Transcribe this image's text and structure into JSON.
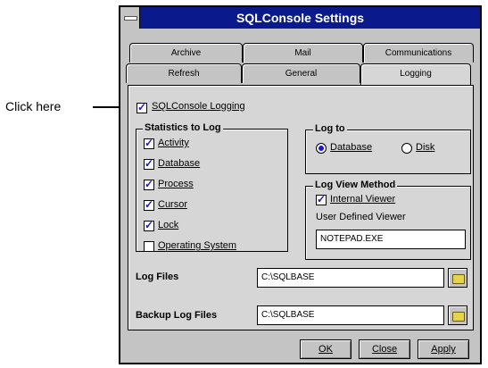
{
  "callout": {
    "label": "Click here"
  },
  "window": {
    "title": "SQLConsole Settings"
  },
  "tabs": {
    "row1": [
      "Archive",
      "Mail",
      "Communications"
    ],
    "row2": [
      "Refresh",
      "General",
      "Logging"
    ],
    "active": "Logging"
  },
  "logging": {
    "label": "SQLConsole Logging",
    "checked": true
  },
  "stats": {
    "title": "Statistics to Log",
    "items": [
      {
        "label": "Activity",
        "checked": true
      },
      {
        "label": "Database",
        "checked": true
      },
      {
        "label": "Process",
        "checked": true
      },
      {
        "label": "Cursor",
        "checked": true
      },
      {
        "label": "Lock",
        "checked": true
      },
      {
        "label": "Operating System",
        "checked": false
      }
    ]
  },
  "log_to": {
    "title": "Log to",
    "options": [
      {
        "label": "Database",
        "selected": true
      },
      {
        "label": "Disk",
        "selected": false
      }
    ]
  },
  "view_method": {
    "title": "Log View Method",
    "internal_label": "Internal Viewer",
    "internal_checked": true,
    "user_defined_label": "User Defined Viewer",
    "user_defined_value": "NOTEPAD.EXE"
  },
  "log_files": {
    "label": "Log Files",
    "value": "C:\\SQLBASE"
  },
  "backup_log_files": {
    "label": "Backup Log Files",
    "value": "C:\\SQLBASE"
  },
  "buttons": {
    "ok": "OK",
    "close": "Close",
    "apply": "Apply"
  }
}
